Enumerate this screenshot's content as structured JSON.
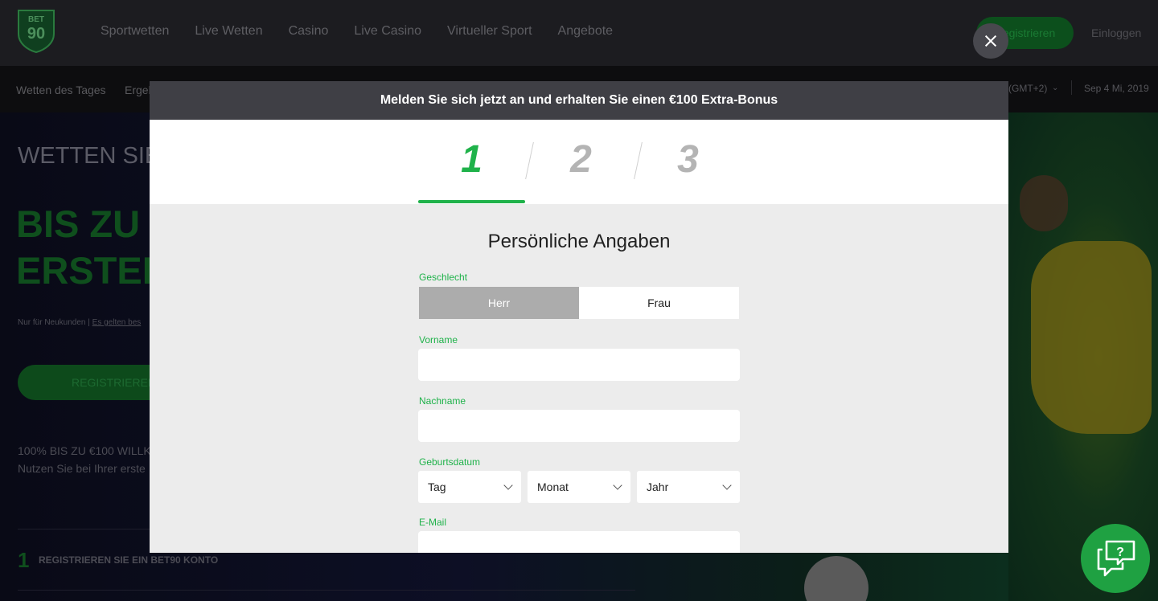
{
  "app": {
    "logo": {
      "top_text": "BET",
      "bottom_text": "90"
    }
  },
  "topnav": {
    "items": [
      "Sportwetten",
      "Live Wetten",
      "Casino",
      "Live Casino",
      "Virtueller Sport",
      "Angebote"
    ],
    "register_label": "Registrieren",
    "login_label": "Einloggen"
  },
  "subnav": {
    "items": [
      "Wetten des Tages",
      "Ergeb"
    ],
    "timezone": "(GMT+2)",
    "date": "Sep 4 Mi, 2019"
  },
  "hero": {
    "headline": "WETTEN SIE",
    "big_line1": "BIS ZU",
    "big_line2": "ERSTEI",
    "fine_print_prefix": "Nur für Neukunden | ",
    "fine_print_link": "Es gelten bes",
    "register_label": "REGISTRIEREN",
    "promo_line1": "100% BIS ZU €100 WILLK",
    "promo_line2": "Nutzen Sie bei Ihrer erste",
    "step_number": "1",
    "step_text": "REGISTRIEREN SIE EIN BET90 KONTO"
  },
  "modal": {
    "header": "Melden Sie sich jetzt an und erhalten Sie einen €100 Extra-Bonus",
    "steps": [
      "1",
      "2",
      "3"
    ],
    "active_step": 1,
    "title": "Persönliche Angaben",
    "gender": {
      "label": "Geschlecht",
      "options": [
        "Herr",
        "Frau"
      ],
      "selected": "Herr"
    },
    "first_name": {
      "label": "Vorname",
      "value": ""
    },
    "last_name": {
      "label": "Nachname",
      "value": ""
    },
    "birthdate": {
      "label": "Geburtsdatum",
      "day": "Tag",
      "month": "Monat",
      "year": "Jahr"
    },
    "email": {
      "label": "E-Mail",
      "value": ""
    }
  },
  "icons": {
    "close": "close-icon",
    "chevron": "chevron-down-icon",
    "chat": "chat-help-icon"
  },
  "colors": {
    "accent": "#1fb24a",
    "modal_header": "#3f3f45",
    "segment_selected": "#acacac"
  }
}
